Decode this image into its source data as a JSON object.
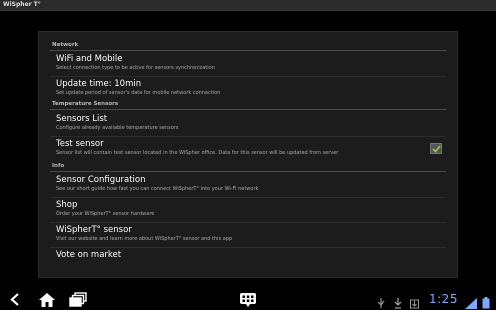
{
  "app": {
    "title": "WiSpher T°"
  },
  "categories": {
    "network": "Network",
    "temperature": "Temperature Sensors",
    "info": "Info"
  },
  "prefs": {
    "wifi": {
      "title": "WiFi and Mobile",
      "summary": "Select connection type to be active for sensors synchronization"
    },
    "update": {
      "title": "Update time: 10min",
      "summary": "Set update period of sensor's data for mobile network connection"
    },
    "sensors_list": {
      "title": "Sensors List",
      "summary": "Configure already available temperature sensors"
    },
    "test_sensor": {
      "title": "Test sensor",
      "summary": "Sensor list will contain test sensor located in the WiSpher office. Data for this sensor will be updated from server",
      "checked": true
    },
    "config": {
      "title": "Sensor Configuration",
      "summary": "See our short guide how fast you can connect WiSpherT° into your Wi-Fi network"
    },
    "shop": {
      "title": "Shop",
      "summary": "Order your WiSpherT° sensor hardware"
    },
    "about": {
      "title": "WiSpherT° sensor",
      "summary": "Visit our website and learn more about WiSpherT° sensor and this app"
    },
    "vote": {
      "title": "Vote on market"
    }
  },
  "status": {
    "clock": "1:25"
  },
  "icons": {
    "back": "back-arrow-icon",
    "home": "home-icon",
    "recent": "recent-apps-icon",
    "menu": "menu-icon",
    "usb": "usb-icon",
    "download": "download-icon",
    "wifi": "wifi-signal-icon",
    "battery": "battery-icon"
  },
  "colors": {
    "accent": "#7fa8ff",
    "checkbox_check": "#8fce3a"
  }
}
